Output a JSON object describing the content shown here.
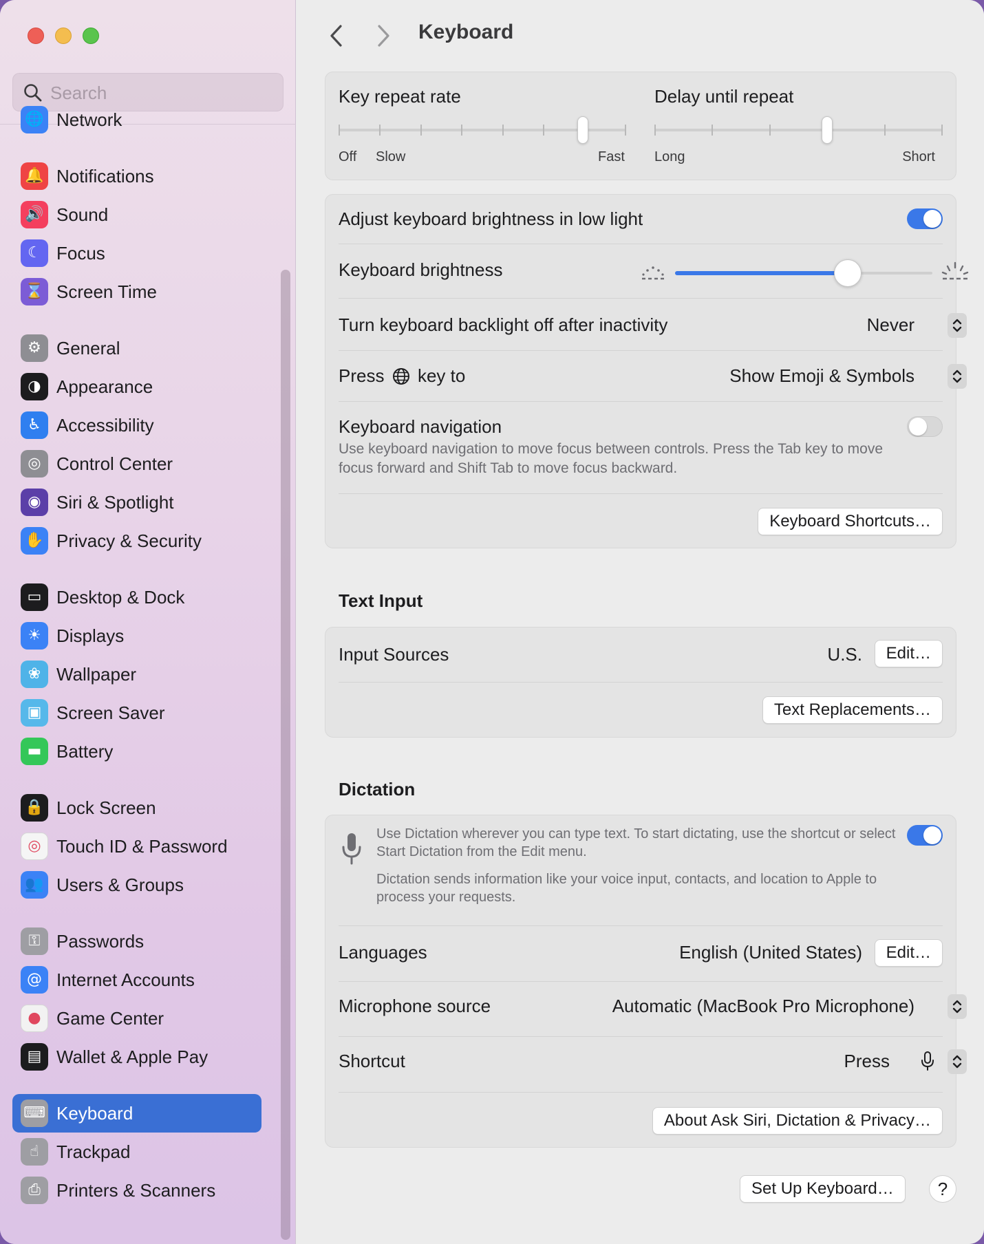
{
  "window": {
    "title": "Keyboard",
    "traffic_lights": [
      "close",
      "minimize",
      "zoom"
    ]
  },
  "search": {
    "placeholder": "Search",
    "value": ""
  },
  "sidebar": {
    "items": [
      {
        "label": "Network",
        "icon": "globe-icon",
        "color": "#3b82f6"
      },
      {
        "label": "Notifications",
        "icon": "bell-icon",
        "color": "#ef4444"
      },
      {
        "label": "Sound",
        "icon": "speaker-icon",
        "color": "#f43f5e"
      },
      {
        "label": "Focus",
        "icon": "moon-icon",
        "color": "#6366f1"
      },
      {
        "label": "Screen Time",
        "icon": "hourglass-icon",
        "color": "#7c5cd6"
      },
      {
        "label": "General",
        "icon": "gear-icon",
        "color": "#8e8e93"
      },
      {
        "label": "Appearance",
        "icon": "appearance-icon",
        "color": "#1c1c1e"
      },
      {
        "label": "Accessibility",
        "icon": "accessibility-icon",
        "color": "#2f7ff0"
      },
      {
        "label": "Control Center",
        "icon": "control-center-icon",
        "color": "#8e8e93"
      },
      {
        "label": "Siri & Spotlight",
        "icon": "siri-icon",
        "color": "#5b3fa8"
      },
      {
        "label": "Privacy & Security",
        "icon": "hand-icon",
        "color": "#3b82f6"
      },
      {
        "label": "Desktop & Dock",
        "icon": "dock-icon",
        "color": "#1c1c1e"
      },
      {
        "label": "Displays",
        "icon": "sun-icon",
        "color": "#3b82f6"
      },
      {
        "label": "Wallpaper",
        "icon": "flower-icon",
        "color": "#4fb3e8"
      },
      {
        "label": "Screen Saver",
        "icon": "screen-saver-icon",
        "color": "#56b8ea"
      },
      {
        "label": "Battery",
        "icon": "battery-icon",
        "color": "#34c759"
      },
      {
        "label": "Lock Screen",
        "icon": "lock-icon",
        "color": "#1c1c1e"
      },
      {
        "label": "Touch ID & Password",
        "icon": "fingerprint-icon",
        "color": "#f5f5f5"
      },
      {
        "label": "Users & Groups",
        "icon": "users-icon",
        "color": "#3b82f6"
      },
      {
        "label": "Passwords",
        "icon": "key-icon",
        "color": "#9e9ea3"
      },
      {
        "label": "Internet Accounts",
        "icon": "at-icon",
        "color": "#3b82f6"
      },
      {
        "label": "Game Center",
        "icon": "game-center-icon",
        "color": "#f2f2f2"
      },
      {
        "label": "Wallet & Apple Pay",
        "icon": "wallet-icon",
        "color": "#1c1c1e"
      },
      {
        "label": "Keyboard",
        "icon": "keyboard-icon",
        "color": "#9e9ea3",
        "selected": true
      },
      {
        "label": "Trackpad",
        "icon": "trackpad-icon",
        "color": "#9e9ea3"
      },
      {
        "label": "Printers & Scanners",
        "icon": "printer-icon",
        "color": "#9e9ea3"
      }
    ]
  },
  "header": {
    "title": "Keyboard",
    "back_label": "Back",
    "forward_label": "Forward"
  },
  "repeat": {
    "key_repeat_label": "Key repeat rate",
    "key_repeat_off": "Off",
    "key_repeat_slow": "Slow",
    "key_repeat_fast": "Fast",
    "key_repeat_value": 0.85,
    "delay_label": "Delay until repeat",
    "delay_long": "Long",
    "delay_short": "Short",
    "delay_value": 0.6
  },
  "brightness": {
    "adjust_label": "Adjust keyboard brightness in low light",
    "adjust_on": true,
    "brightness_label": "Keyboard brightness",
    "brightness_value": 0.67,
    "backlight_label": "Turn keyboard backlight off after inactivity",
    "backlight_value": "Never",
    "press_prefix": "Press",
    "press_suffix": "key to",
    "press_value": "Show Emoji & Symbols",
    "nav_label": "Keyboard navigation",
    "nav_desc": "Use keyboard navigation to move focus between controls. Press the Tab key to move focus forward and Shift Tab to move focus backward.",
    "nav_on": false,
    "shortcuts_button": "Keyboard Shortcuts…"
  },
  "text_input": {
    "title": "Text Input",
    "sources_label": "Input Sources",
    "sources_value": "U.S.",
    "edit_button": "Edit…",
    "replacements_button": "Text Replacements…"
  },
  "dictation": {
    "title": "Dictation",
    "desc1": "Use Dictation wherever you can type text. To start dictating, use the shortcut or select Start Dictation from the Edit menu.",
    "desc2": "Dictation sends information like your voice input, contacts, and location to Apple to process your requests.",
    "enabled": true,
    "languages_label": "Languages",
    "languages_value": "English (United States)",
    "edit_button": "Edit…",
    "mic_label": "Microphone source",
    "mic_value": "Automatic (MacBook Pro Microphone)",
    "shortcut_label": "Shortcut",
    "shortcut_value": "Press",
    "about_button": "About Ask Siri, Dictation & Privacy…"
  },
  "footer": {
    "setup_button": "Set Up Keyboard…",
    "help_button": "?"
  }
}
